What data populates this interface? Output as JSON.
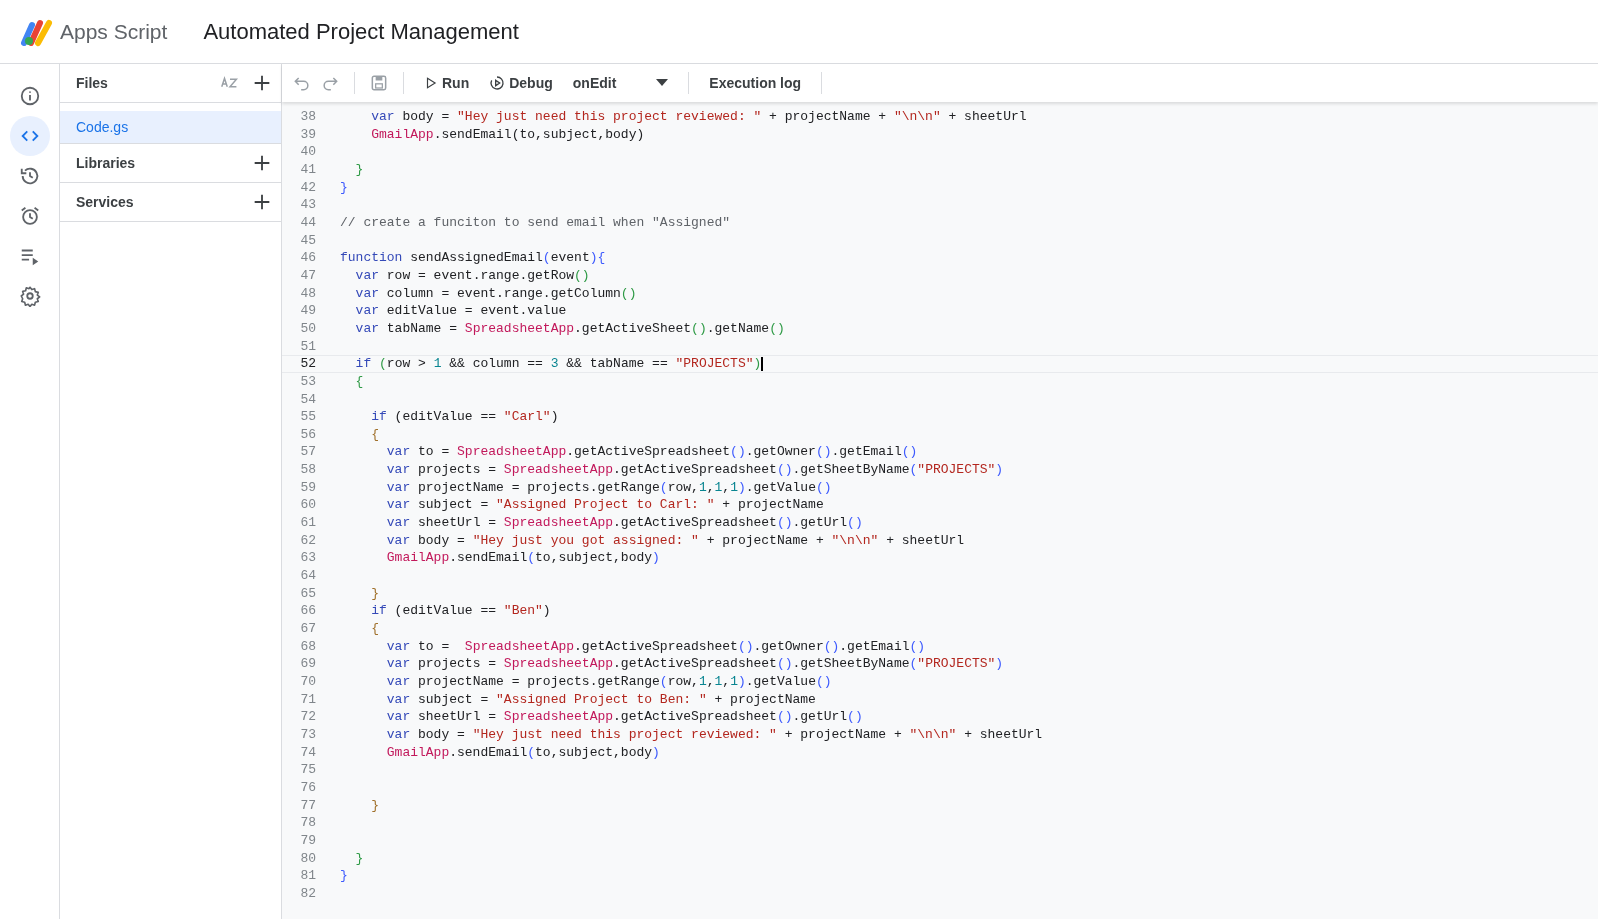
{
  "header": {
    "product": "Apps Script",
    "project_title": "Automated Project Management"
  },
  "rail": [
    {
      "kind": "info",
      "selected": false
    },
    {
      "kind": "code",
      "selected": true
    },
    {
      "kind": "history",
      "selected": false
    },
    {
      "kind": "triggers",
      "selected": false
    },
    {
      "kind": "executions",
      "selected": false
    },
    {
      "kind": "settings",
      "selected": false
    }
  ],
  "files_panel": {
    "title": "Files",
    "files": [
      {
        "name": "Code.gs",
        "selected": true
      }
    ],
    "sections": [
      "Libraries",
      "Services"
    ]
  },
  "toolbar": {
    "run": "Run",
    "debug": "Debug",
    "function": "onEdit",
    "execution_log": "Execution log"
  },
  "code": [
    {
      "number": "38",
      "current": false,
      "tokens": [
        {
          "kind": "kw",
          "text": "    var"
        },
        {
          "kind": "t",
          "text": " body = "
        },
        {
          "kind": "str",
          "text": "\"Hey just need this project reviewed: \""
        },
        {
          "kind": "t",
          "text": " + projectName + "
        },
        {
          "kind": "str",
          "text": "\"\\n\\n\""
        },
        {
          "kind": "t",
          "text": " + sheetUrl"
        }
      ]
    },
    {
      "number": "39",
      "current": false,
      "tokens": [
        {
          "kind": "cls",
          "text": "    GmailApp"
        },
        {
          "kind": "t",
          "text": ".sendEmail(to,subject,body)"
        }
      ]
    },
    {
      "number": "40",
      "current": false
    },
    {
      "number": "41",
      "current": false,
      "tokens": [
        {
          "kind": "b2",
          "text": "  }"
        }
      ]
    },
    {
      "number": "42",
      "current": false,
      "tokens": [
        {
          "kind": "b1",
          "text": "}"
        }
      ]
    },
    {
      "number": "43",
      "current": false
    },
    {
      "number": "44",
      "current": false,
      "tokens": [
        {
          "kind": "com",
          "text": "// create a funciton to send email when \"Assigned\""
        }
      ]
    },
    {
      "number": "45",
      "current": false
    },
    {
      "number": "46",
      "current": false,
      "tokens": [
        {
          "kind": "kw",
          "text": "function"
        },
        {
          "kind": "t",
          "text": " sendAssignedEmail"
        },
        {
          "kind": "b1",
          "text": "("
        },
        {
          "kind": "t",
          "text": "event"
        },
        {
          "kind": "b1",
          "text": "){"
        }
      ]
    },
    {
      "number": "47",
      "current": false,
      "tokens": [
        {
          "kind": "kw",
          "text": "  var"
        },
        {
          "kind": "t",
          "text": " row = event.range.getRow"
        },
        {
          "kind": "b2",
          "text": "()"
        }
      ]
    },
    {
      "number": "48",
      "current": false,
      "tokens": [
        {
          "kind": "kw",
          "text": "  var"
        },
        {
          "kind": "t",
          "text": " column = event.range.getColumn"
        },
        {
          "kind": "b2",
          "text": "()"
        }
      ]
    },
    {
      "number": "49",
      "current": false,
      "tokens": [
        {
          "kind": "kw",
          "text": "  var"
        },
        {
          "kind": "t",
          "text": " editValue = event.value"
        }
      ]
    },
    {
      "number": "50",
      "current": false,
      "tokens": [
        {
          "kind": "kw",
          "text": "  var"
        },
        {
          "kind": "t",
          "text": " tabName = "
        },
        {
          "kind": "cls",
          "text": "SpreadsheetApp"
        },
        {
          "kind": "t",
          "text": ".getActiveSheet"
        },
        {
          "kind": "b2",
          "text": "()"
        },
        {
          "kind": "t",
          "text": ".getName"
        },
        {
          "kind": "b2",
          "text": "()"
        }
      ]
    },
    {
      "number": "51",
      "current": false
    },
    {
      "number": "52",
      "current": true,
      "tokens": [
        {
          "kind": "kw",
          "text": "  if"
        },
        {
          "kind": "b2",
          "text": " ("
        },
        {
          "kind": "t",
          "text": "row > "
        },
        {
          "kind": "num",
          "text": "1"
        },
        {
          "kind": "t",
          "text": " && column == "
        },
        {
          "kind": "num",
          "text": "3"
        },
        {
          "kind": "t",
          "text": " && tabName == "
        },
        {
          "kind": "str",
          "text": "\"PROJECTS\""
        },
        {
          "kind": "b2",
          "text": ")"
        }
      ]
    },
    {
      "number": "53",
      "current": false,
      "tokens": [
        {
          "kind": "b2",
          "text": "  {"
        }
      ]
    },
    {
      "number": "54",
      "current": false
    },
    {
      "number": "55",
      "current": false,
      "tokens": [
        {
          "kind": "kw",
          "text": "    if"
        },
        {
          "kind": "t",
          "text": " (editValue == "
        },
        {
          "kind": "str",
          "text": "\"Carl\""
        },
        {
          "kind": "t",
          "text": ")"
        }
      ]
    },
    {
      "number": "56",
      "current": false,
      "tokens": [
        {
          "kind": "b3",
          "text": "    {"
        }
      ]
    },
    {
      "number": "57",
      "current": false,
      "tokens": [
        {
          "kind": "kw",
          "text": "      var"
        },
        {
          "kind": "t",
          "text": " to = "
        },
        {
          "kind": "cls",
          "text": "SpreadsheetApp"
        },
        {
          "kind": "t",
          "text": ".getActiveSpreadsheet"
        },
        {
          "kind": "b1",
          "text": "()"
        },
        {
          "kind": "t",
          "text": ".getOwner"
        },
        {
          "kind": "b1",
          "text": "()"
        },
        {
          "kind": "t",
          "text": ".getEmail"
        },
        {
          "kind": "b1",
          "text": "()"
        }
      ]
    },
    {
      "number": "58",
      "current": false,
      "tokens": [
        {
          "kind": "kw",
          "text": "      var"
        },
        {
          "kind": "t",
          "text": " projects = "
        },
        {
          "kind": "cls",
          "text": "SpreadsheetApp"
        },
        {
          "kind": "t",
          "text": ".getActiveSpreadsheet"
        },
        {
          "kind": "b1",
          "text": "()"
        },
        {
          "kind": "t",
          "text": ".getSheetByName"
        },
        {
          "kind": "b1",
          "text": "("
        },
        {
          "kind": "str",
          "text": "\"PROJECTS\""
        },
        {
          "kind": "b1",
          "text": ")"
        }
      ]
    },
    {
      "number": "59",
      "current": false,
      "tokens": [
        {
          "kind": "kw",
          "text": "      var"
        },
        {
          "kind": "t",
          "text": " projectName = projects.getRange"
        },
        {
          "kind": "b1",
          "text": "("
        },
        {
          "kind": "t",
          "text": "row,"
        },
        {
          "kind": "num",
          "text": "1"
        },
        {
          "kind": "t",
          "text": ","
        },
        {
          "kind": "num",
          "text": "1"
        },
        {
          "kind": "t",
          "text": ","
        },
        {
          "kind": "num",
          "text": "1"
        },
        {
          "kind": "b1",
          "text": ")"
        },
        {
          "kind": "t",
          "text": ".getValue"
        },
        {
          "kind": "b1",
          "text": "()"
        }
      ]
    },
    {
      "number": "60",
      "current": false,
      "tokens": [
        {
          "kind": "kw",
          "text": "      var"
        },
        {
          "kind": "t",
          "text": " subject = "
        },
        {
          "kind": "str",
          "text": "\"Assigned Project to Carl: \""
        },
        {
          "kind": "t",
          "text": " + projectName"
        }
      ]
    },
    {
      "number": "61",
      "current": false,
      "tokens": [
        {
          "kind": "kw",
          "text": "      var"
        },
        {
          "kind": "t",
          "text": " sheetUrl = "
        },
        {
          "kind": "cls",
          "text": "SpreadsheetApp"
        },
        {
          "kind": "t",
          "text": ".getActiveSpreadsheet"
        },
        {
          "kind": "b1",
          "text": "()"
        },
        {
          "kind": "t",
          "text": ".getUrl"
        },
        {
          "kind": "b1",
          "text": "()"
        }
      ]
    },
    {
      "number": "62",
      "current": false,
      "tokens": [
        {
          "kind": "kw",
          "text": "      var"
        },
        {
          "kind": "t",
          "text": " body = "
        },
        {
          "kind": "str",
          "text": "\"Hey just you got assigned: \""
        },
        {
          "kind": "t",
          "text": " + projectName + "
        },
        {
          "kind": "str",
          "text": "\"\\n\\n\""
        },
        {
          "kind": "t",
          "text": " + sheetUrl"
        }
      ]
    },
    {
      "number": "63",
      "current": false,
      "tokens": [
        {
          "kind": "cls",
          "text": "      GmailApp"
        },
        {
          "kind": "t",
          "text": ".sendEmail"
        },
        {
          "kind": "b1",
          "text": "("
        },
        {
          "kind": "t",
          "text": "to,subject,body"
        },
        {
          "kind": "b1",
          "text": ")"
        }
      ]
    },
    {
      "number": "64",
      "current": false
    },
    {
      "number": "65",
      "current": false,
      "tokens": [
        {
          "kind": "b3",
          "text": "    }"
        }
      ]
    },
    {
      "number": "66",
      "current": false,
      "tokens": [
        {
          "kind": "kw",
          "text": "    if"
        },
        {
          "kind": "t",
          "text": " (editValue == "
        },
        {
          "kind": "str",
          "text": "\"Ben\""
        },
        {
          "kind": "t",
          "text": ")"
        }
      ]
    },
    {
      "number": "67",
      "current": false,
      "tokens": [
        {
          "kind": "b3",
          "text": "    {"
        }
      ]
    },
    {
      "number": "68",
      "current": false,
      "tokens": [
        {
          "kind": "kw",
          "text": "      var"
        },
        {
          "kind": "t",
          "text": " to =  "
        },
        {
          "kind": "cls",
          "text": "SpreadsheetApp"
        },
        {
          "kind": "t",
          "text": ".getActiveSpreadsheet"
        },
        {
          "kind": "b1",
          "text": "()"
        },
        {
          "kind": "t",
          "text": ".getOwner"
        },
        {
          "kind": "b1",
          "text": "()"
        },
        {
          "kind": "t",
          "text": ".getEmail"
        },
        {
          "kind": "b1",
          "text": "()"
        }
      ]
    },
    {
      "number": "69",
      "current": false,
      "tokens": [
        {
          "kind": "kw",
          "text": "      var"
        },
        {
          "kind": "t",
          "text": " projects = "
        },
        {
          "kind": "cls",
          "text": "SpreadsheetApp"
        },
        {
          "kind": "t",
          "text": ".getActiveSpreadsheet"
        },
        {
          "kind": "b1",
          "text": "()"
        },
        {
          "kind": "t",
          "text": ".getSheetByName"
        },
        {
          "kind": "b1",
          "text": "("
        },
        {
          "kind": "str",
          "text": "\"PROJECTS\""
        },
        {
          "kind": "b1",
          "text": ")"
        }
      ]
    },
    {
      "number": "70",
      "current": false,
      "tokens": [
        {
          "kind": "kw",
          "text": "      var"
        },
        {
          "kind": "t",
          "text": " projectName = projects.getRange"
        },
        {
          "kind": "b1",
          "text": "("
        },
        {
          "kind": "t",
          "text": "row,"
        },
        {
          "kind": "num",
          "text": "1"
        },
        {
          "kind": "t",
          "text": ","
        },
        {
          "kind": "num",
          "text": "1"
        },
        {
          "kind": "t",
          "text": ","
        },
        {
          "kind": "num",
          "text": "1"
        },
        {
          "kind": "b1",
          "text": ")"
        },
        {
          "kind": "t",
          "text": ".getValue"
        },
        {
          "kind": "b1",
          "text": "()"
        }
      ]
    },
    {
      "number": "71",
      "current": false,
      "tokens": [
        {
          "kind": "kw",
          "text": "      var"
        },
        {
          "kind": "t",
          "text": " subject = "
        },
        {
          "kind": "str",
          "text": "\"Assigned Project to Ben: \""
        },
        {
          "kind": "t",
          "text": " + projectName"
        }
      ]
    },
    {
      "number": "72",
      "current": false,
      "tokens": [
        {
          "kind": "kw",
          "text": "      var"
        },
        {
          "kind": "t",
          "text": " sheetUrl = "
        },
        {
          "kind": "cls",
          "text": "SpreadsheetApp"
        },
        {
          "kind": "t",
          "text": ".getActiveSpreadsheet"
        },
        {
          "kind": "b1",
          "text": "()"
        },
        {
          "kind": "t",
          "text": ".getUrl"
        },
        {
          "kind": "b1",
          "text": "()"
        }
      ]
    },
    {
      "number": "73",
      "current": false,
      "tokens": [
        {
          "kind": "kw",
          "text": "      var"
        },
        {
          "kind": "t",
          "text": " body = "
        },
        {
          "kind": "str",
          "text": "\"Hey just need this project reviewed: \""
        },
        {
          "kind": "t",
          "text": " + projectName + "
        },
        {
          "kind": "str",
          "text": "\"\\n\\n\""
        },
        {
          "kind": "t",
          "text": " + sheetUrl"
        }
      ]
    },
    {
      "number": "74",
      "current": false,
      "tokens": [
        {
          "kind": "cls",
          "text": "      GmailApp"
        },
        {
          "kind": "t",
          "text": ".sendEmail"
        },
        {
          "kind": "b1",
          "text": "("
        },
        {
          "kind": "t",
          "text": "to,subject,body"
        },
        {
          "kind": "b1",
          "text": ")"
        }
      ]
    },
    {
      "number": "75",
      "current": false
    },
    {
      "number": "76",
      "current": false
    },
    {
      "number": "77",
      "current": false,
      "tokens": [
        {
          "kind": "b3",
          "text": "    }"
        }
      ]
    },
    {
      "number": "78",
      "current": false
    },
    {
      "number": "79",
      "current": false
    },
    {
      "number": "80",
      "current": false,
      "tokens": [
        {
          "kind": "b2",
          "text": "  }"
        }
      ]
    },
    {
      "number": "81",
      "current": false,
      "tokens": [
        {
          "kind": "b1",
          "text": "}"
        }
      ]
    },
    {
      "number": "82",
      "current": false
    }
  ]
}
